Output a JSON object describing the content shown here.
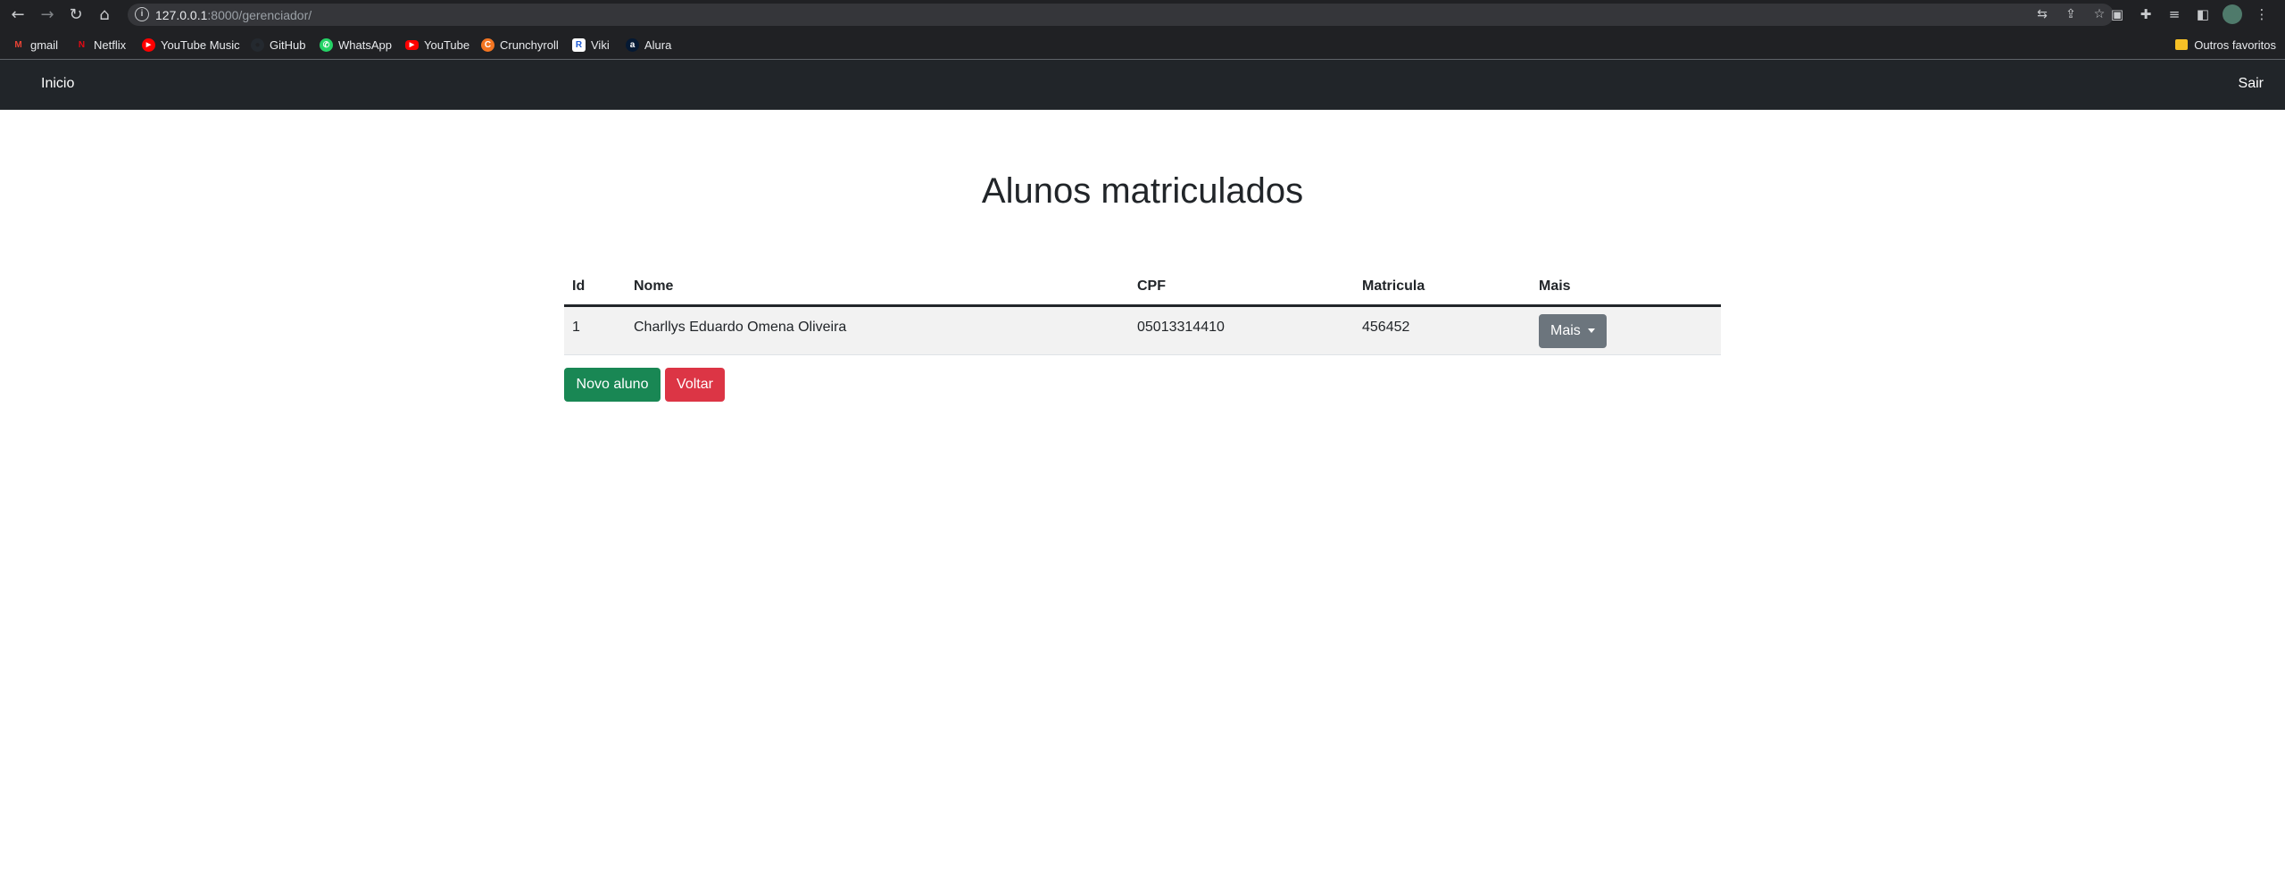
{
  "browser": {
    "url_host": "127.0.0.1",
    "url_path": ":8000/gerenciador/",
    "bookmarks": [
      {
        "label": "gmail",
        "color": "#ea4335",
        "glyph": "M"
      },
      {
        "label": "Netflix",
        "color": "#e50914",
        "glyph": "N"
      },
      {
        "label": "YouTube Music",
        "color": "#ff0000",
        "glyph": "▶"
      },
      {
        "label": "GitHub",
        "color": "#24292f",
        "glyph": "●"
      },
      {
        "label": "WhatsApp",
        "color": "#25d366",
        "glyph": "✆"
      },
      {
        "label": "YouTube",
        "color": "#ff0000",
        "glyph": "▶"
      },
      {
        "label": "Crunchyroll",
        "color": "#f47521",
        "glyph": "C"
      },
      {
        "label": "Viki",
        "color": "#ffffff",
        "glyph": "R"
      },
      {
        "label": "Alura",
        "color": "#051933",
        "glyph": "a"
      }
    ],
    "other_bookmarks_label": "Outros favoritos"
  },
  "navbar": {
    "home_label": "Inicio",
    "exit_label": "Sair"
  },
  "page": {
    "title": "Alunos matriculados"
  },
  "table": {
    "headers": {
      "id": "Id",
      "nome": "Nome",
      "cpf": "CPF",
      "matricula": "Matricula",
      "mais": "Mais"
    },
    "rows": [
      {
        "id": "1",
        "nome": "Charllys Eduardo Omena Oliveira",
        "cpf": "05013314410",
        "matricula": "456452",
        "more_label": "Mais"
      }
    ]
  },
  "actions": {
    "new_student_label": "Novo aluno",
    "back_label": "Voltar"
  },
  "colors": {
    "navbar_bg": "#212529",
    "success": "#198754",
    "danger": "#dc3545",
    "secondary": "#6c757d"
  }
}
